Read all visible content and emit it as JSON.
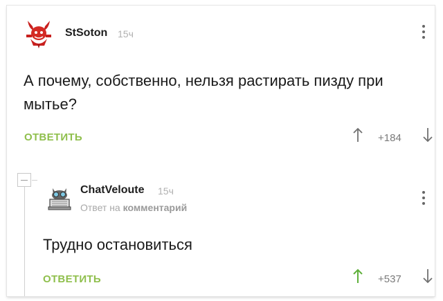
{
  "comments": [
    {
      "author": "StSoton",
      "time": "15ч",
      "text": "А почему, собственно, нельзя растирать пизду при мытье?",
      "reply_label": "ОТВЕТИТЬ",
      "rating": "+184"
    },
    {
      "author": "ChatVeloute",
      "time": "15ч",
      "reply_to_prefix": "Ответ на",
      "reply_to_target": "комментарий",
      "text": "Трудно остановиться",
      "reply_label": "ОТВЕТИТЬ",
      "rating": "+537"
    }
  ],
  "colors": {
    "accent_green": "#8fbf4c",
    "upvote_active": "#5fb03a",
    "text": "#1a1a1a",
    "muted": "#b0b0b0"
  },
  "icons": {
    "avatar1": "devil-avatar-icon",
    "avatar2": "cat-laptop-avatar-icon",
    "menu": "more-vertical-icon",
    "upvote": "arrow-up-icon",
    "downvote": "arrow-down-icon",
    "collapse": "collapse-minus-icon"
  }
}
